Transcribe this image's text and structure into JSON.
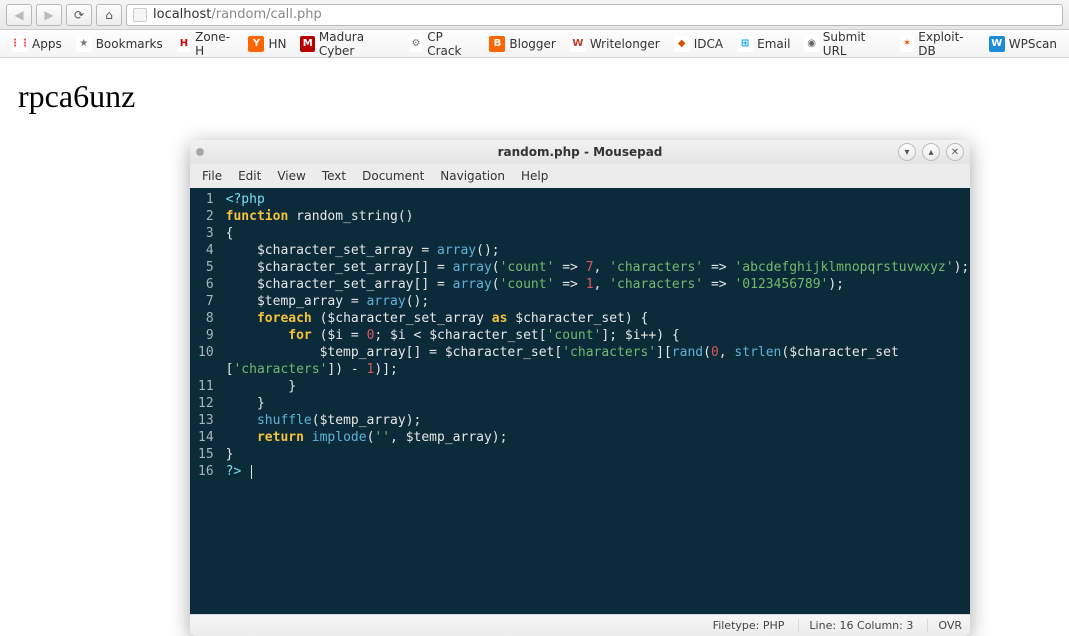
{
  "browser": {
    "url_host": "localhost",
    "url_path": "/random/call.php"
  },
  "bookmarks": [
    {
      "label": "Apps",
      "name": "apps",
      "color": "#fff",
      "glyph": "⋮⋮",
      "glyphColor": "#f33c2f"
    },
    {
      "label": "Bookmarks",
      "name": "bookmarks",
      "color": "#fff",
      "glyph": "★",
      "glyphColor": "#777"
    },
    {
      "label": "Zone-H",
      "name": "zone-h",
      "color": "#fff",
      "glyph": "H",
      "glyphColor": "#d90000"
    },
    {
      "label": "HN",
      "name": "hn",
      "color": "#ff6600",
      "glyph": "Y",
      "glyphColor": "#fff"
    },
    {
      "label": "Madura Cyber",
      "name": "madura-cyber",
      "color": "#b80000",
      "glyph": "M",
      "glyphColor": "#fff"
    },
    {
      "label": "CP Crack",
      "name": "cp-crack",
      "color": "#fff",
      "glyph": "⚙",
      "glyphColor": "#777"
    },
    {
      "label": "Blogger",
      "name": "blogger",
      "color": "#ff6600",
      "glyph": "B",
      "glyphColor": "#fff"
    },
    {
      "label": "Writelonger",
      "name": "writelonger",
      "color": "#fff",
      "glyph": "W",
      "glyphColor": "#c0392b"
    },
    {
      "label": "IDCA",
      "name": "idca",
      "color": "#fff",
      "glyph": "◆",
      "glyphColor": "#d35400"
    },
    {
      "label": "Email",
      "name": "email",
      "color": "#fff",
      "glyph": "⊞",
      "glyphColor": "#00a4ef"
    },
    {
      "label": "Submit URL",
      "name": "submit-url",
      "color": "#fff",
      "glyph": "◉",
      "glyphColor": "#666"
    },
    {
      "label": "Exploit-DB",
      "name": "exploit-db",
      "color": "#fff",
      "glyph": "✶",
      "glyphColor": "#e55a00"
    },
    {
      "label": "WPScan",
      "name": "wpscan",
      "color": "#1a8cd8",
      "glyph": "W",
      "glyphColor": "#fff"
    }
  ],
  "page": {
    "output": "rpca6unz"
  },
  "editor": {
    "title": "random.php - Mousepad",
    "menu": [
      "File",
      "Edit",
      "View",
      "Text",
      "Document",
      "Navigation",
      "Help"
    ],
    "code": [
      {
        "n": 1,
        "tokens": [
          [
            "tag",
            "<?php"
          ]
        ]
      },
      {
        "n": 2,
        "tokens": [
          [
            "kw",
            "function"
          ],
          [
            "sp",
            " "
          ],
          [
            "fn",
            "random_string"
          ],
          [
            "op",
            "()"
          ]
        ]
      },
      {
        "n": 3,
        "tokens": [
          [
            "brace",
            "{"
          ]
        ]
      },
      {
        "n": 4,
        "tokens": [
          [
            "sp",
            "    "
          ],
          [
            "var",
            "$character_set_array"
          ],
          [
            "sp",
            " "
          ],
          [
            "op",
            "="
          ],
          [
            "sp",
            " "
          ],
          [
            "call",
            "array"
          ],
          [
            "op",
            "();"
          ]
        ]
      },
      {
        "n": 5,
        "tokens": [
          [
            "sp",
            "    "
          ],
          [
            "var",
            "$character_set_array[]"
          ],
          [
            "sp",
            " "
          ],
          [
            "op",
            "="
          ],
          [
            "sp",
            " "
          ],
          [
            "call",
            "array"
          ],
          [
            "op",
            "("
          ],
          [
            "str",
            "'count'"
          ],
          [
            "sp",
            " "
          ],
          [
            "op",
            "=>"
          ],
          [
            "sp",
            " "
          ],
          [
            "num",
            "7"
          ],
          [
            "op",
            ","
          ],
          [
            "sp",
            " "
          ],
          [
            "str",
            "'characters'"
          ],
          [
            "sp",
            " "
          ],
          [
            "op",
            "=>"
          ],
          [
            "sp",
            " "
          ],
          [
            "str",
            "'abcdefghijklmnopqrstuvwxyz'"
          ],
          [
            "op",
            ");"
          ]
        ]
      },
      {
        "n": 6,
        "tokens": [
          [
            "sp",
            "    "
          ],
          [
            "var",
            "$character_set_array[]"
          ],
          [
            "sp",
            " "
          ],
          [
            "op",
            "="
          ],
          [
            "sp",
            " "
          ],
          [
            "call",
            "array"
          ],
          [
            "op",
            "("
          ],
          [
            "str",
            "'count'"
          ],
          [
            "sp",
            " "
          ],
          [
            "op",
            "=>"
          ],
          [
            "sp",
            " "
          ],
          [
            "num",
            "1"
          ],
          [
            "op",
            ","
          ],
          [
            "sp",
            " "
          ],
          [
            "str",
            "'characters'"
          ],
          [
            "sp",
            " "
          ],
          [
            "op",
            "=>"
          ],
          [
            "sp",
            " "
          ],
          [
            "str",
            "'0123456789'"
          ],
          [
            "op",
            ");"
          ]
        ]
      },
      {
        "n": 7,
        "tokens": [
          [
            "sp",
            "    "
          ],
          [
            "var",
            "$temp_array"
          ],
          [
            "sp",
            " "
          ],
          [
            "op",
            "="
          ],
          [
            "sp",
            " "
          ],
          [
            "call",
            "array"
          ],
          [
            "op",
            "();"
          ]
        ]
      },
      {
        "n": 8,
        "tokens": [
          [
            "sp",
            "    "
          ],
          [
            "kw",
            "foreach"
          ],
          [
            "sp",
            " "
          ],
          [
            "op",
            "("
          ],
          [
            "var",
            "$character_set_array"
          ],
          [
            "sp",
            " "
          ],
          [
            "kw",
            "as"
          ],
          [
            "sp",
            " "
          ],
          [
            "var",
            "$character_set"
          ],
          [
            "op",
            ")"
          ],
          [
            "sp",
            " "
          ],
          [
            "brace",
            "{"
          ]
        ]
      },
      {
        "n": 9,
        "tokens": [
          [
            "sp",
            "        "
          ],
          [
            "kw",
            "for"
          ],
          [
            "sp",
            " "
          ],
          [
            "op",
            "("
          ],
          [
            "var",
            "$i"
          ],
          [
            "sp",
            " "
          ],
          [
            "op",
            "="
          ],
          [
            "sp",
            " "
          ],
          [
            "num",
            "0"
          ],
          [
            "op",
            ";"
          ],
          [
            "sp",
            " "
          ],
          [
            "var",
            "$i"
          ],
          [
            "sp",
            " "
          ],
          [
            "op",
            "<"
          ],
          [
            "sp",
            " "
          ],
          [
            "var",
            "$character_set"
          ],
          [
            "op",
            "["
          ],
          [
            "str",
            "'count'"
          ],
          [
            "op",
            "];"
          ],
          [
            "sp",
            " "
          ],
          [
            "var",
            "$i++"
          ],
          [
            "op",
            ")"
          ],
          [
            "sp",
            " "
          ],
          [
            "brace",
            "{"
          ]
        ]
      },
      {
        "n": 10,
        "tokens": [
          [
            "sp",
            "            "
          ],
          [
            "var",
            "$temp_array[]"
          ],
          [
            "sp",
            " "
          ],
          [
            "op",
            "="
          ],
          [
            "sp",
            " "
          ],
          [
            "var",
            "$character_set"
          ],
          [
            "op",
            "["
          ],
          [
            "str",
            "'characters'"
          ],
          [
            "op",
            "]["
          ],
          [
            "call",
            "rand"
          ],
          [
            "op",
            "("
          ],
          [
            "num",
            "0"
          ],
          [
            "op",
            ","
          ],
          [
            "sp",
            " "
          ],
          [
            "call",
            "strlen"
          ],
          [
            "op",
            "("
          ],
          [
            "var",
            "$character_set"
          ]
        ]
      },
      {
        "n": "",
        "tokens": [
          [
            "op",
            "["
          ],
          [
            "str",
            "'characters'"
          ],
          [
            "op",
            "])"
          ],
          [
            "sp",
            " "
          ],
          [
            "op",
            "-"
          ],
          [
            "sp",
            " "
          ],
          [
            "num",
            "1"
          ],
          [
            "op",
            ")];"
          ]
        ]
      },
      {
        "n": 11,
        "tokens": [
          [
            "sp",
            "        "
          ],
          [
            "brace",
            "}"
          ]
        ]
      },
      {
        "n": 12,
        "tokens": [
          [
            "sp",
            "    "
          ],
          [
            "brace",
            "}"
          ]
        ]
      },
      {
        "n": 13,
        "tokens": [
          [
            "sp",
            "    "
          ],
          [
            "call",
            "shuffle"
          ],
          [
            "op",
            "("
          ],
          [
            "var",
            "$temp_array"
          ],
          [
            "op",
            ");"
          ]
        ]
      },
      {
        "n": 14,
        "tokens": [
          [
            "sp",
            "    "
          ],
          [
            "kw",
            "return"
          ],
          [
            "sp",
            " "
          ],
          [
            "call",
            "implode"
          ],
          [
            "op",
            "("
          ],
          [
            "str",
            "''"
          ],
          [
            "op",
            ","
          ],
          [
            "sp",
            " "
          ],
          [
            "var",
            "$temp_array"
          ],
          [
            "op",
            ");"
          ]
        ]
      },
      {
        "n": 15,
        "tokens": [
          [
            "brace",
            "}"
          ]
        ]
      },
      {
        "n": 16,
        "tokens": [
          [
            "tag",
            "?>"
          ],
          [
            "sp",
            " "
          ],
          [
            "cursor",
            ""
          ]
        ]
      }
    ],
    "status": {
      "filetype": "Filetype: PHP",
      "position": "Line: 16 Column: 3",
      "mode": "OVR"
    }
  }
}
